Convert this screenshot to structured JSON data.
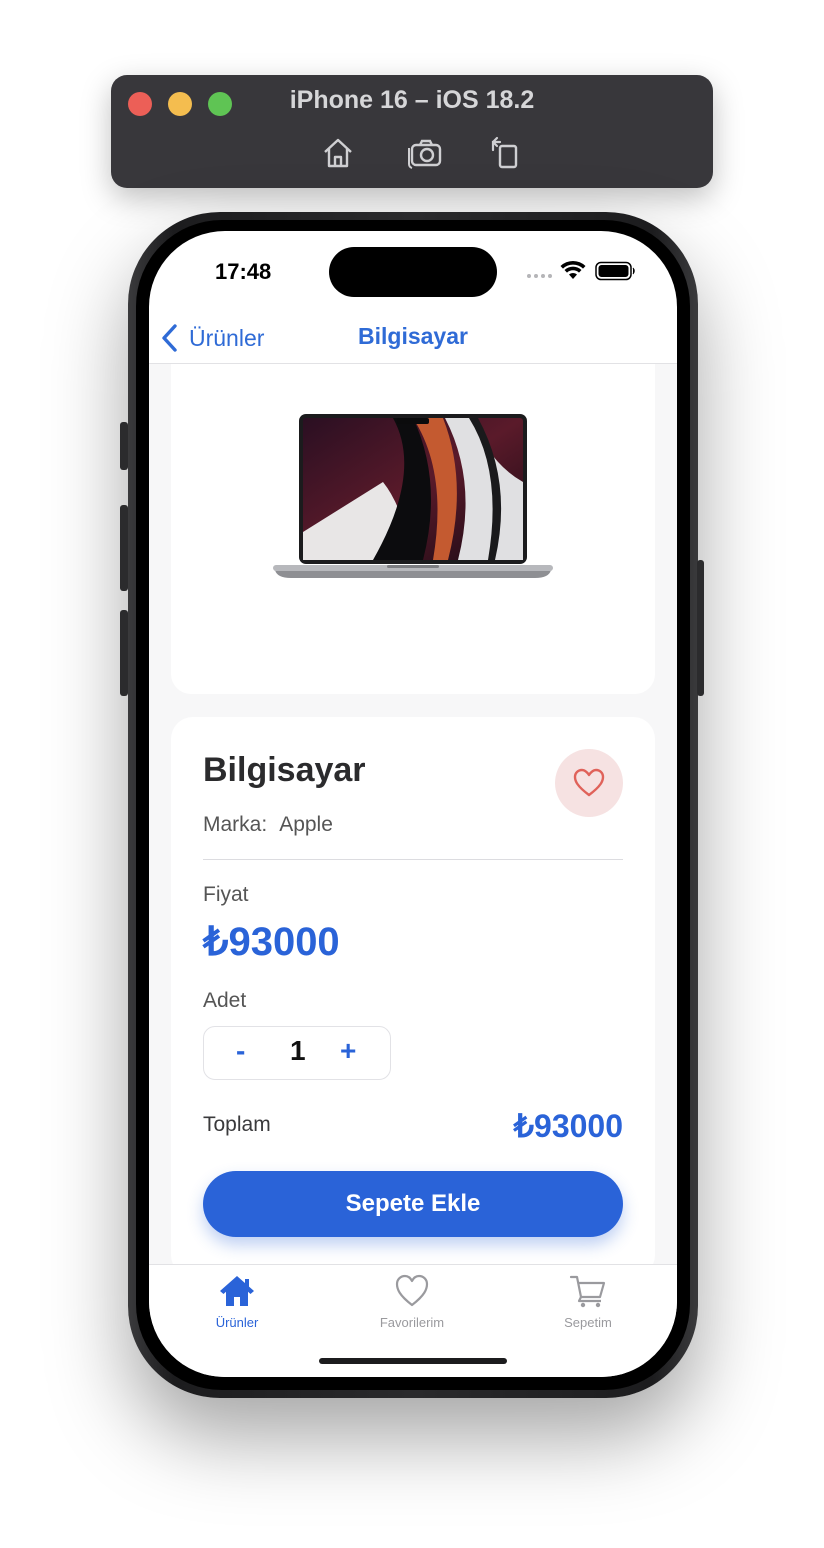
{
  "simulator": {
    "title": "iPhone 16 – iOS 18.2",
    "tools": [
      "home-icon",
      "screenshot-icon",
      "rotate-icon"
    ]
  },
  "status_bar": {
    "time": "17:48"
  },
  "nav": {
    "back_label": "Ürünler",
    "title": "Bilgisayar"
  },
  "product": {
    "name": "Bilgisayar",
    "brand_label": "Marka:",
    "brand_value": "Apple",
    "price_label": "Fiyat",
    "price": "₺93000",
    "qty_label": "Adet",
    "qty_minus": "-",
    "qty": "1",
    "qty_plus": "+",
    "total_label": "Toplam",
    "total": "₺93000",
    "add_button": "Sepete Ekle"
  },
  "tabs": [
    {
      "label": "Ürünler",
      "icon": "house-icon",
      "active": true
    },
    {
      "label": "Favorilerim",
      "icon": "heart-icon",
      "active": false
    },
    {
      "label": "Sepetim",
      "icon": "cart-icon",
      "active": false
    }
  ],
  "colors": {
    "accent": "#2a63d8",
    "inactive": "#9a9a9e",
    "fav_bg": "#f6e2e2",
    "fav_heart": "#e0625a"
  }
}
